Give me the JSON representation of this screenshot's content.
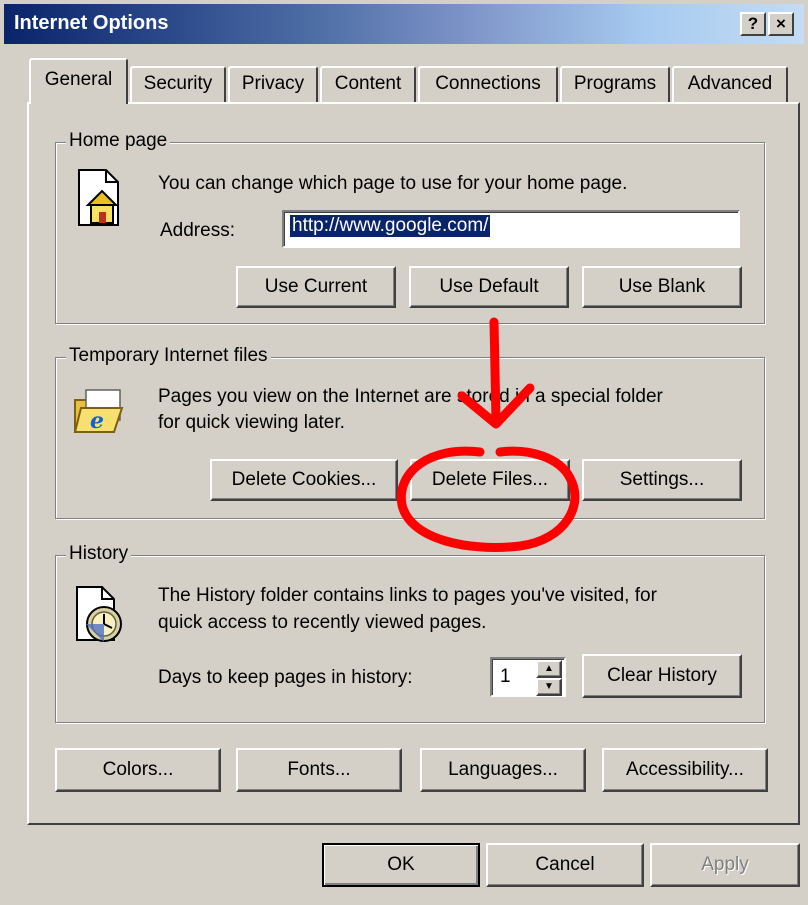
{
  "window": {
    "title": "Internet Options",
    "help_button": "?",
    "close_button": "×"
  },
  "tabs": [
    {
      "label": "General",
      "active": true
    },
    {
      "label": "Security"
    },
    {
      "label": "Privacy"
    },
    {
      "label": "Content"
    },
    {
      "label": "Connections"
    },
    {
      "label": "Programs"
    },
    {
      "label": "Advanced"
    }
  ],
  "home_page": {
    "legend": "Home page",
    "description": "You can change which page to use for your home page.",
    "address_label": "Address:",
    "address_value": "http://www.google.com/",
    "use_current": "Use Current",
    "use_default": "Use Default",
    "use_blank": "Use Blank"
  },
  "temp_files": {
    "legend": "Temporary Internet files",
    "description_line1": "Pages you view on the Internet are stored in a special folder",
    "description_line2": "for quick viewing later.",
    "delete_cookies": "Delete Cookies...",
    "delete_files": "Delete Files...",
    "settings": "Settings..."
  },
  "history": {
    "legend": "History",
    "description_line1": "The History folder contains links to pages you've visited, for",
    "description_line2": "quick access to recently viewed pages.",
    "days_label": "Days to keep pages in history:",
    "days_value": "1",
    "clear_history": "Clear History"
  },
  "bottom_buttons": {
    "colors": "Colors...",
    "fonts": "Fonts...",
    "languages": "Languages...",
    "accessibility": "Accessibility..."
  },
  "dialog_buttons": {
    "ok": "OK",
    "cancel": "Cancel",
    "apply": "Apply"
  },
  "colors": {
    "annotation": "#ff0000",
    "selection": "#0a246a",
    "face": "#d4d0c8"
  }
}
